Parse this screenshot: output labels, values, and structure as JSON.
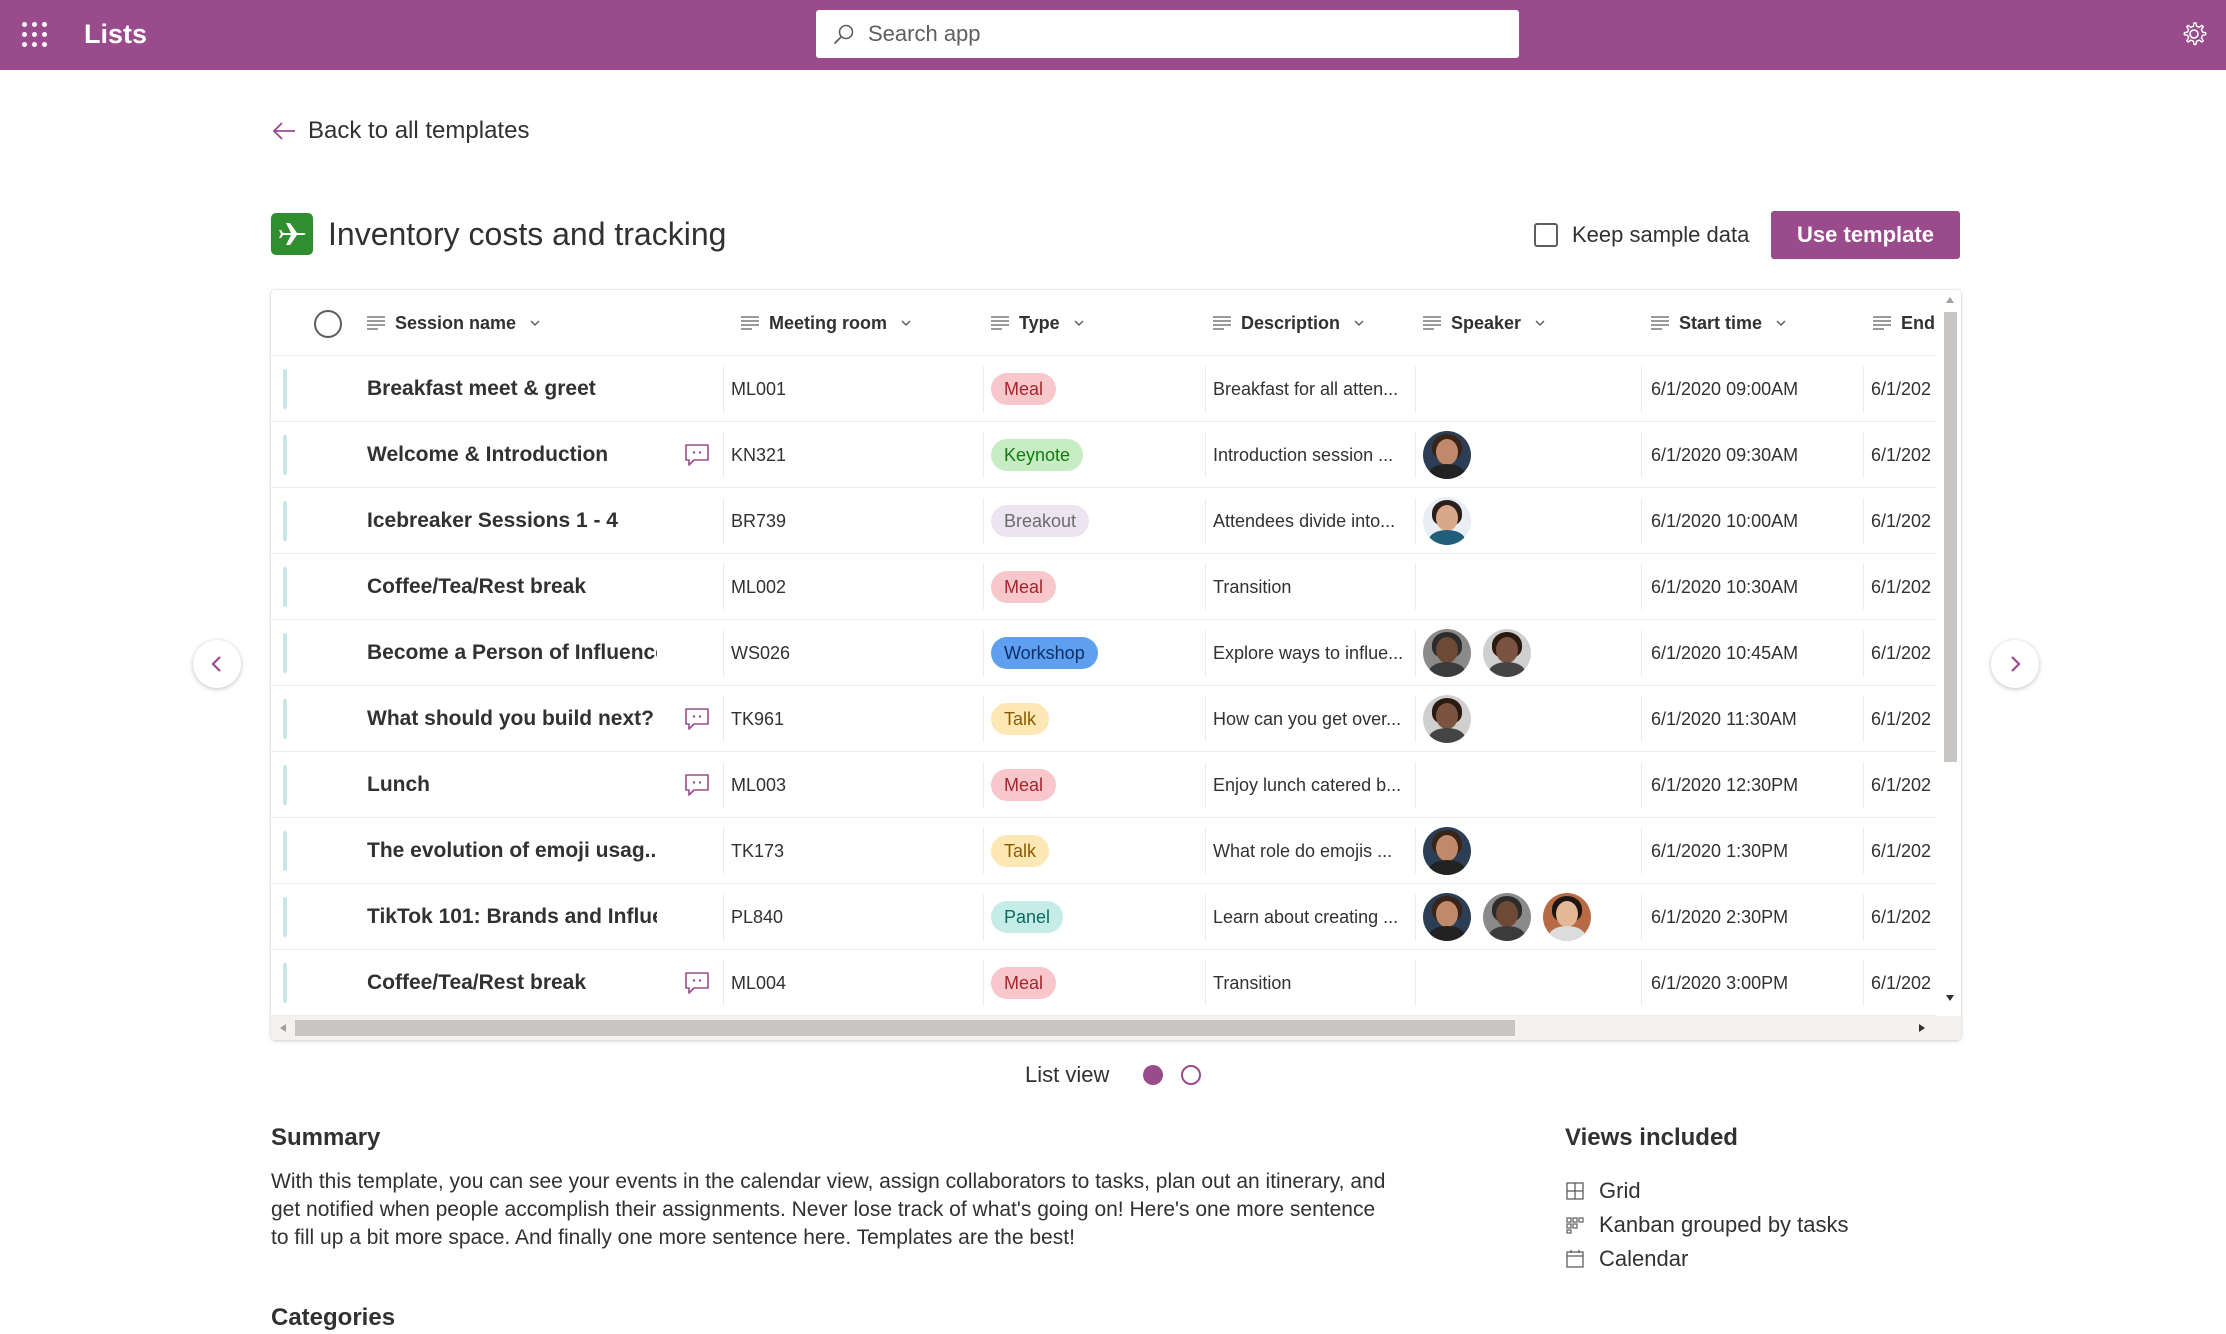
{
  "app": {
    "name": "Lists"
  },
  "search": {
    "placeholder": "Search app"
  },
  "back": {
    "label": "Back to all templates"
  },
  "template": {
    "title": "Inventory costs and tracking",
    "keep_sample_label": "Keep sample data",
    "use_button": "Use template"
  },
  "colors": {
    "brand": "#9a4b8c",
    "template_icon": "#2f8f2f"
  },
  "grid": {
    "columns": [
      "Session name",
      "Meeting room",
      "Type",
      "Description",
      "Speaker",
      "Start time",
      "End"
    ],
    "rows": [
      {
        "name": "Breakfast meet & greet",
        "comment": false,
        "room": "ML001",
        "type": "Meal",
        "desc": "Breakfast for all atten...",
        "speakers": [],
        "start": "6/1/2020 09:00AM",
        "end": "6/1/202"
      },
      {
        "name": "Welcome & Introduction",
        "comment": true,
        "room": "KN321",
        "type": "Keynote",
        "desc": "Introduction session ...",
        "speakers": [
          "a"
        ],
        "start": "6/1/2020 09:30AM",
        "end": "6/1/202"
      },
      {
        "name": "Icebreaker Sessions 1 - 4",
        "comment": false,
        "room": "BR739",
        "type": "Breakout",
        "desc": "Attendees divide into...",
        "speakers": [
          "b"
        ],
        "start": "6/1/2020 10:00AM",
        "end": "6/1/202"
      },
      {
        "name": "Coffee/Tea/Rest break",
        "comment": false,
        "room": "ML002",
        "type": "Meal",
        "desc": "Transition",
        "speakers": [],
        "start": "6/1/2020 10:30AM",
        "end": "6/1/202"
      },
      {
        "name": "Become a Person of Influence",
        "comment": false,
        "room": "WS026",
        "type": "Workshop",
        "desc": "Explore ways to influe...",
        "speakers": [
          "c",
          "d"
        ],
        "start": "6/1/2020 10:45AM",
        "end": "6/1/202"
      },
      {
        "name": "What should you build next?",
        "comment": true,
        "room": "TK961",
        "type": "Talk",
        "desc": "How can you get over...",
        "speakers": [
          "d"
        ],
        "start": "6/1/2020 11:30AM",
        "end": "6/1/202"
      },
      {
        "name": "Lunch",
        "comment": true,
        "room": "ML003",
        "type": "Meal",
        "desc": "Enjoy lunch catered b...",
        "speakers": [],
        "start": "6/1/2020 12:30PM",
        "end": "6/1/202"
      },
      {
        "name": "The evolution of emoji usag...",
        "comment": false,
        "room": "TK173",
        "type": "Talk",
        "desc": "What role do emojis ...",
        "speakers": [
          "a"
        ],
        "start": "6/1/2020 1:30PM",
        "end": "6/1/202"
      },
      {
        "name": "TikTok 101: Brands and Influe...",
        "comment": false,
        "room": "PL840",
        "type": "Panel",
        "desc": "Learn about creating ...",
        "speakers": [
          "a",
          "c",
          "e"
        ],
        "start": "6/1/2020 2:30PM",
        "end": "6/1/202"
      },
      {
        "name": "Coffee/Tea/Rest break",
        "comment": true,
        "room": "ML004",
        "type": "Meal",
        "desc": "Transition",
        "speakers": [],
        "start": "6/1/2020 3:00PM",
        "end": "6/1/202"
      }
    ],
    "type_colors": {
      "Meal": {
        "bg": "#f7c7cc",
        "fg": "#a4262c"
      },
      "Keynote": {
        "bg": "#c7ebc2",
        "fg": "#107c10"
      },
      "Breakout": {
        "bg": "#ece4f0",
        "fg": "#6b6b6b"
      },
      "Workshop": {
        "bg": "#5ea0ef",
        "fg": "#0b2f66"
      },
      "Talk": {
        "bg": "#fde7b5",
        "fg": "#8a5c00"
      },
      "Panel": {
        "bg": "#c6ece8",
        "fg": "#0b6a60"
      }
    }
  },
  "pager": {
    "label": "List view"
  },
  "summary": {
    "heading": "Summary",
    "text": "With this template, you can see your events in the calendar view, assign collaborators to tasks, plan out an itinerary, and get notified when people accomplish their assignments. Never lose track of what's going on! Here's one more sentence to fill up a bit more space. And finally one more sentence here. Templates are the best!"
  },
  "views": {
    "heading": "Views included",
    "items": [
      {
        "label": "Grid",
        "icon": "grid-icon"
      },
      {
        "label": "Kanban grouped by tasks",
        "icon": "kanban-icon"
      },
      {
        "label": "Calendar",
        "icon": "calendar-icon"
      }
    ]
  },
  "categories": {
    "heading": "Categories"
  }
}
